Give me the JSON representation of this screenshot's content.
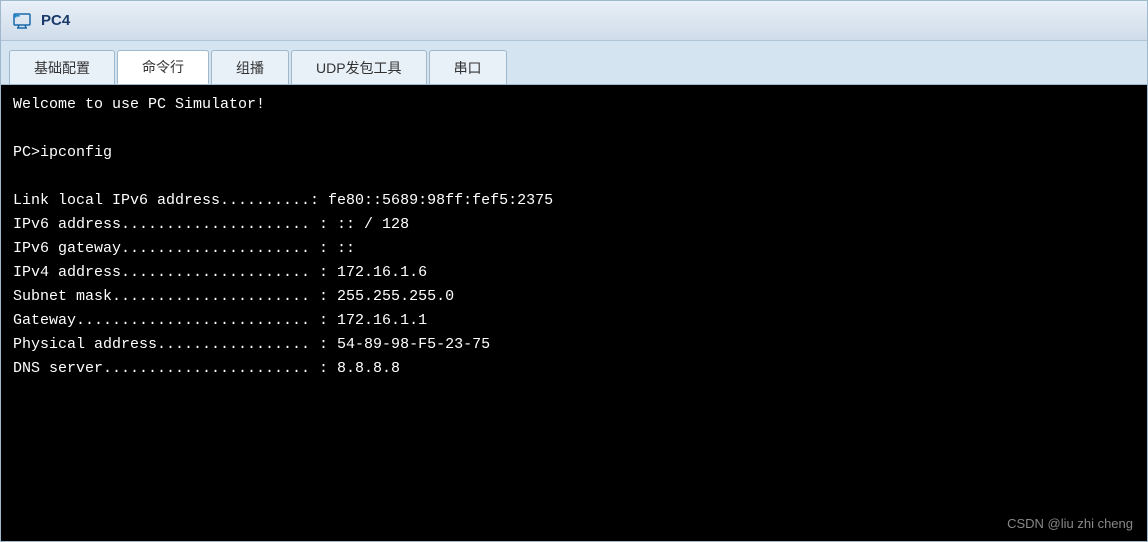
{
  "window": {
    "title": "PC4"
  },
  "tabs": [
    {
      "id": "basic-config",
      "label": "基础配置",
      "active": false
    },
    {
      "id": "command-line",
      "label": "命令行",
      "active": true
    },
    {
      "id": "multicast",
      "label": "组播",
      "active": false
    },
    {
      "id": "udp-tool",
      "label": "UDP发包工具",
      "active": false
    },
    {
      "id": "serial",
      "label": "串口",
      "active": false
    }
  ],
  "terminal": {
    "lines": [
      "Welcome to use PC Simulator!",
      "",
      "PC>ipconfig",
      "",
      "Link local IPv6 address..........: fe80::5689:98ff:fef5:2375",
      "IPv6 address..................... : :: / 128",
      "IPv6 gateway..................... : ::",
      "IPv4 address..................... : 172.16.1.6",
      "Subnet mask...................... : 255.255.255.0",
      "Gateway.......................... : 172.16.1.1",
      "Physical address................. : 54-89-98-F5-23-75",
      "DNS server....................... : 8.8.8.8"
    ],
    "watermark": "CSDN @liu zhi cheng"
  }
}
